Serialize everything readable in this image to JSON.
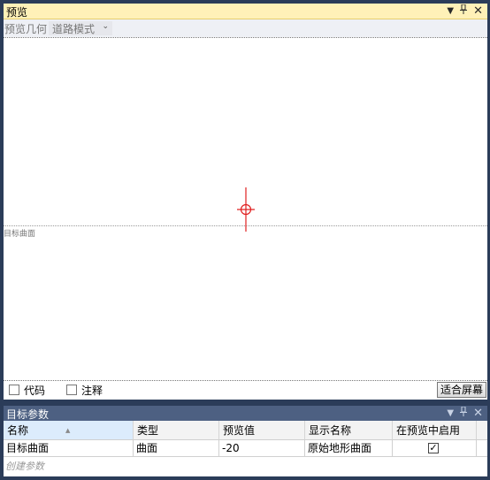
{
  "preview": {
    "title": "预览",
    "toolbar_label": "预览几何",
    "mode_value": "道路模式",
    "surface_label": "目标曲面",
    "checkbox_code_label": "代码",
    "checkbox_annotation_label": "注释",
    "fit_button_label": "适合屏幕"
  },
  "target_params": {
    "title": "目标参数",
    "columns": [
      "名称",
      "类型",
      "预览值",
      "显示名称",
      "在预览中启用"
    ],
    "rows": [
      {
        "name": "目标曲面",
        "type": "曲面",
        "preview_value": "-20",
        "display_name": "原始地形曲面",
        "enabled": true
      }
    ],
    "new_row_placeholder": "创建参数"
  },
  "icons": {
    "dropdown": "chevron-down-icon",
    "pin": "pin-icon",
    "close": "close-icon",
    "crosshair": "crosshair-icon",
    "sort": "sort-ascending-icon",
    "check": "checkmark-icon"
  },
  "colors": {
    "preview_title_bg": "#fff1b8",
    "params_title_bg": "#4d6082",
    "window_bg": "#2b3c59",
    "crosshair": "#e02020",
    "header_selected": "#dcecfc"
  }
}
